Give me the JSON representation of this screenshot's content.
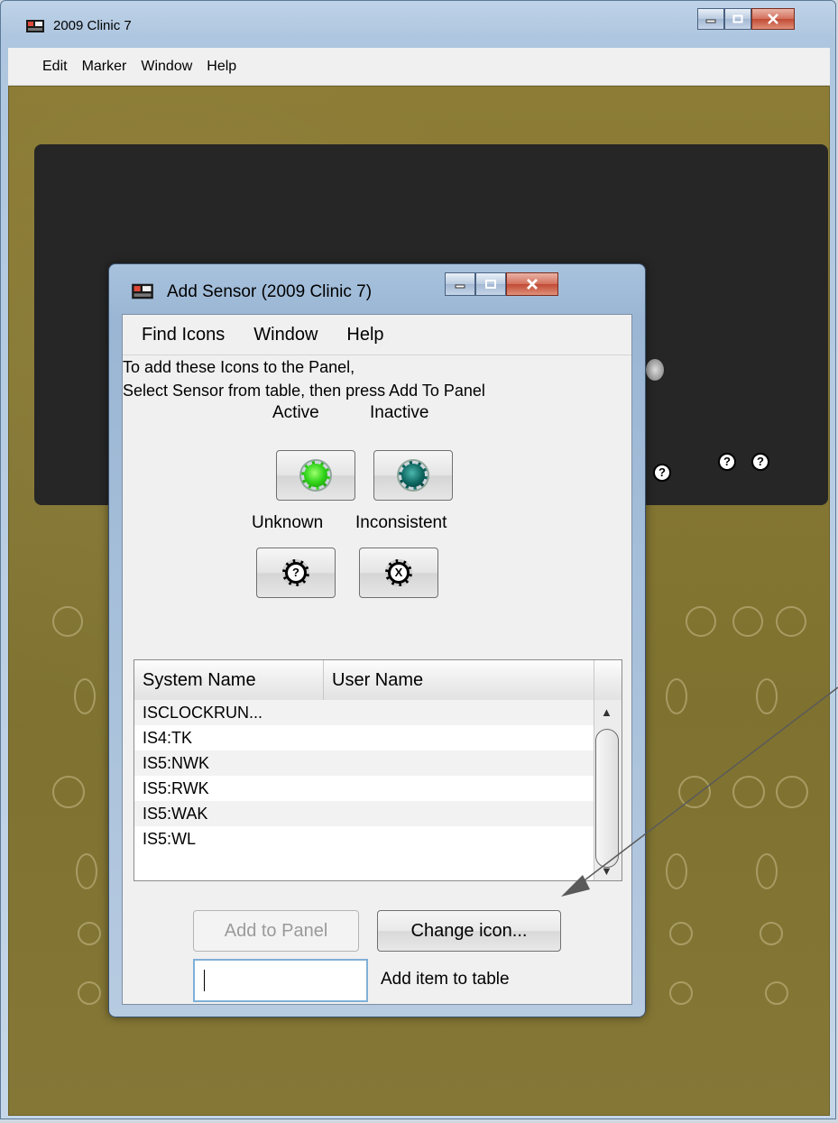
{
  "main_window": {
    "title": "2009 Clinic 7",
    "menu": [
      "Edit",
      "Marker",
      "Window",
      "Help"
    ]
  },
  "dialog": {
    "title": "Add Sensor (2009 Clinic 7)",
    "menu": [
      "Find Icons",
      "Window",
      "Help"
    ],
    "instructions": [
      "To add these Icons to the Panel,",
      "Select Sensor from table, then press Add To Panel"
    ],
    "states": {
      "active": "Active",
      "inactive": "Inactive",
      "unknown": "Unknown",
      "inconsistent": "Inconsistent"
    },
    "table": {
      "columns": [
        "System Name",
        "User Name"
      ],
      "rows": [
        "ISCLOCKRUN...",
        "IS4:TK",
        "IS5:NWK",
        "IS5:RWK",
        "IS5:WAK",
        "IS5:WL"
      ]
    },
    "buttons": {
      "add_to_panel": "Add to Panel",
      "change_icon": "Change icon..."
    },
    "add_item": {
      "value": "",
      "label": "Add item to table"
    },
    "icons": {
      "unknown_symbol": "?",
      "inconsistent_symbol": "X"
    }
  },
  "colors": {
    "active_led": "#31d51a",
    "inactive_led": "#0d6660",
    "panel_background": "#857736",
    "dark_panel": "#262626"
  }
}
